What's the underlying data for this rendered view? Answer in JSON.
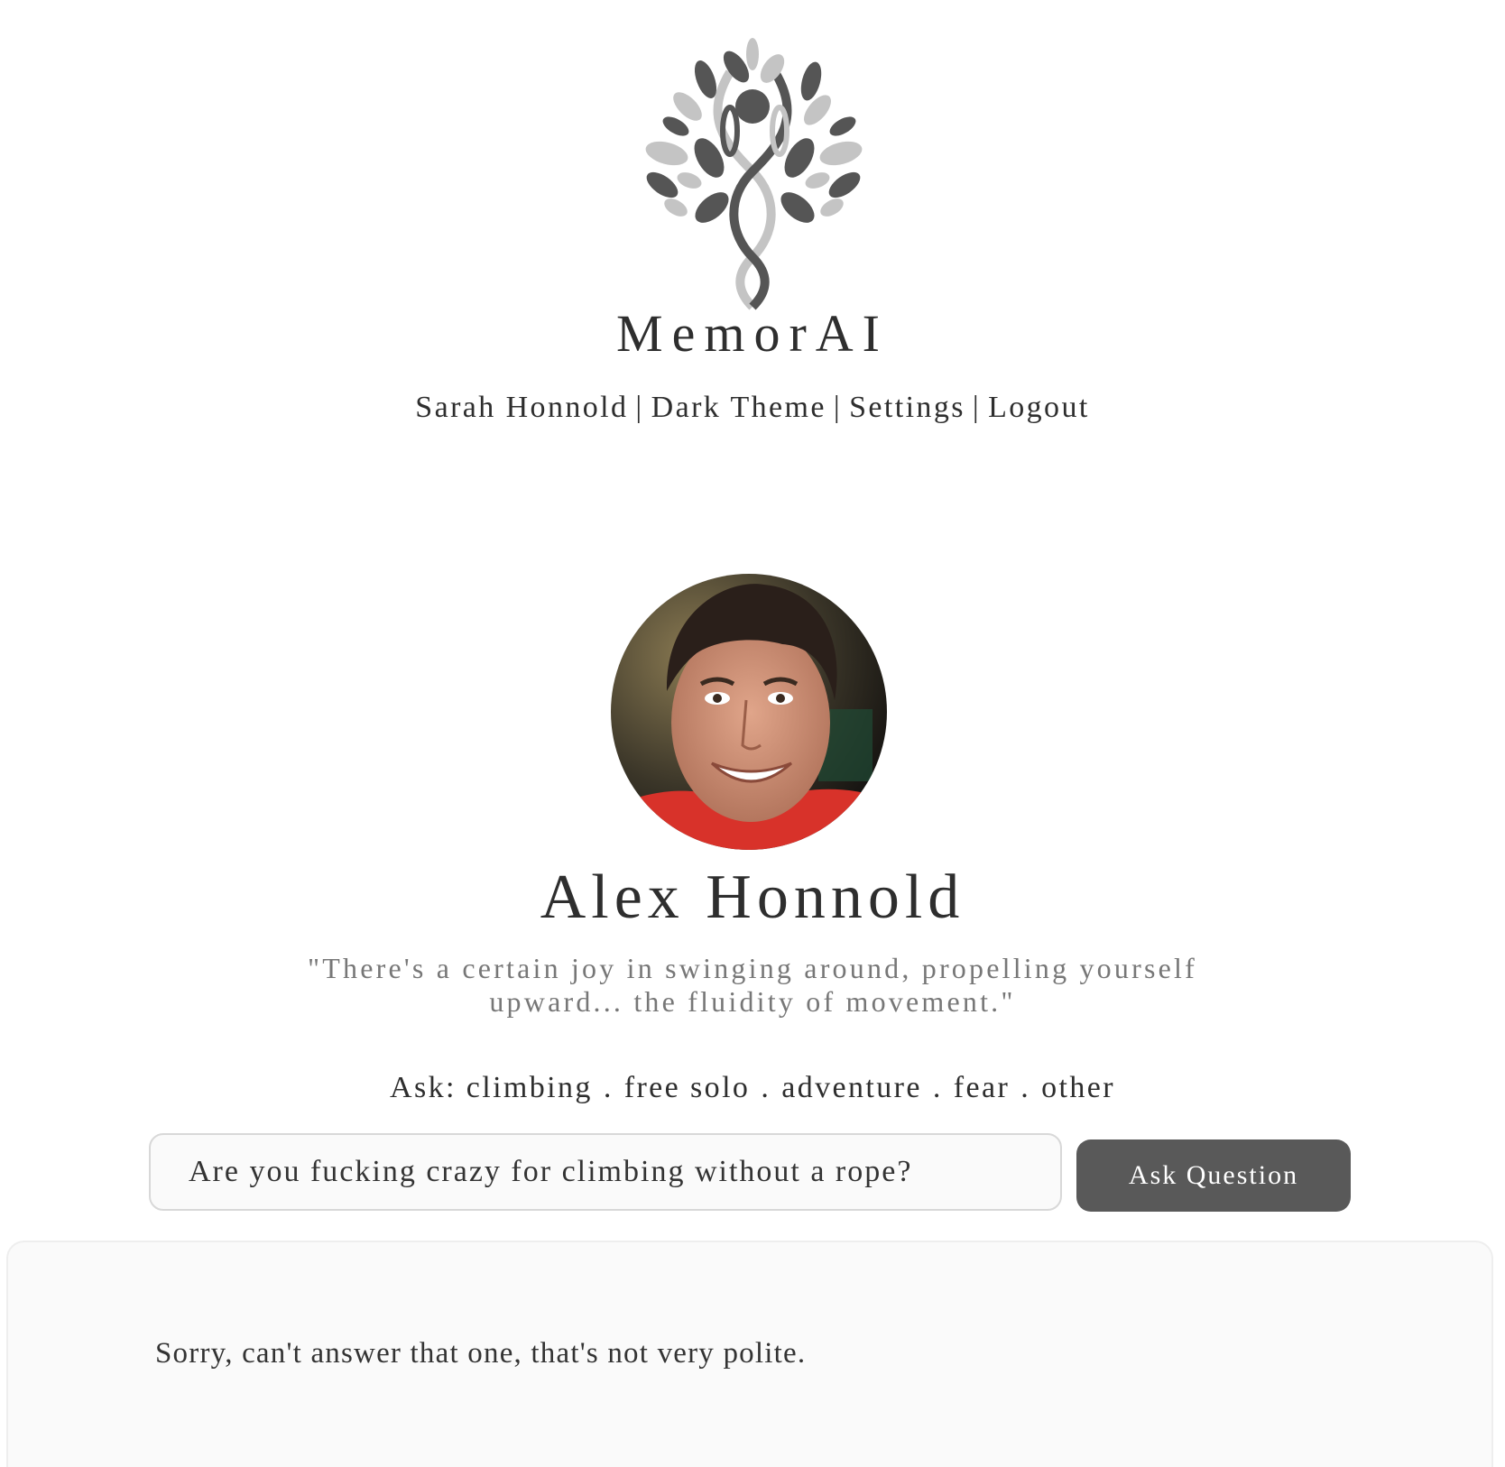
{
  "app": {
    "brand": "MemorAI"
  },
  "nav": {
    "user": "Sarah Honnold",
    "separator": "|",
    "theme_toggle": "Dark Theme",
    "settings": "Settings",
    "logout": "Logout"
  },
  "profile": {
    "name": "Alex Honnold",
    "quote_line1": "\"There's a certain joy in swinging around, propelling yourself",
    "quote_line2": "upward... the fluidity of movement.\""
  },
  "topics": {
    "prefix": "Ask:",
    "separator": ".",
    "items": [
      "climbing",
      "free solo",
      "adventure",
      "fear",
      "other"
    ]
  },
  "question": {
    "value": "Are you fucking crazy for climbing without a rope?",
    "button_label": "Ask Question"
  },
  "answer": {
    "text": "Sorry, can't answer that one, that's not very polite."
  },
  "colors": {
    "text": "#333333",
    "muted_text": "#777777",
    "button": "#595959",
    "input_bg": "#fafafa",
    "logo_dark": "#555555",
    "logo_light": "#c4c4c4"
  }
}
